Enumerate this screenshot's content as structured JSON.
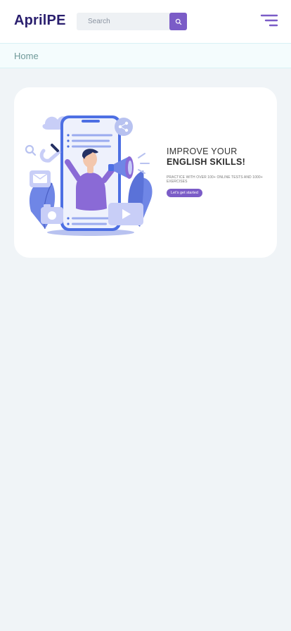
{
  "header": {
    "logo": "AprilPE",
    "search": {
      "placeholder": "Search"
    },
    "icons": {
      "search": "search-icon",
      "menu": "menu-icon"
    }
  },
  "breadcrumb": {
    "home": "Home"
  },
  "hero": {
    "title_line1": "IMPROVE YOUR",
    "title_line2": "ENGLISH SKILLS!",
    "subtitle": "PRACTICE  WITH OVER 100+ ONLINE TESTS AND 1000+ EXERCISES",
    "cta_label": "Let's get started",
    "illustration": "marketing-megaphone-illustration"
  },
  "colors": {
    "brand": "#2a1f6e",
    "accent": "#7b5cc7",
    "background": "#f0f4f7"
  }
}
